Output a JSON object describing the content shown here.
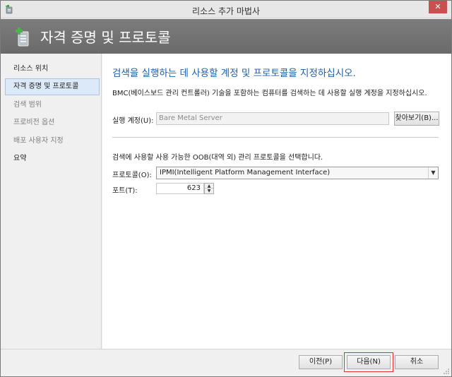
{
  "window": {
    "title": "리소스 추가 마법사",
    "close_glyph": "✕"
  },
  "banner": {
    "title": "자격 증명 및 프로토콜",
    "icon": "wizard-page-icon"
  },
  "nav": {
    "items": [
      {
        "label": "리소스 위치",
        "state": "normal"
      },
      {
        "label": "자격 증명 및 프로토콜",
        "state": "selected"
      },
      {
        "label": "검색 범위",
        "state": "disabled"
      },
      {
        "label": "프로비전 옵션",
        "state": "disabled"
      },
      {
        "label": "배포 사용자 지정",
        "state": "disabled"
      },
      {
        "label": "요약",
        "state": "normal"
      }
    ]
  },
  "main": {
    "heading": "검색을 실행하는 데 사용할 계정 및 프로토콜을 지정하십시오.",
    "description": "BMC(베이스보드 관리 컨트롤러) 기술을 포함하는 컴퓨터를 검색하는 데 사용할 실행 계정을 지정하십시오.",
    "run_as_label": "실행 계정(U):",
    "run_as_value": "Bare Metal Server",
    "browse_label": "찾아보기(B)...",
    "protocol_intro": "검색에 사용할 사용 가능한 OOB(대역 외) 관리 프로토콜을 선택합니다.",
    "protocol_label": "프로토콜(O):",
    "protocol_value": "IPMI(Intelligent Platform Management Interface)",
    "port_label": "포트(T):",
    "port_value": "623"
  },
  "footer": {
    "prev_label": "이전(P)",
    "next_label": "다음(N)",
    "cancel_label": "취소"
  },
  "colors": {
    "heading": "#1f5fa8",
    "banner": "#6e6e6e",
    "selected_nav": "#dbe9f8",
    "highlight": "#e03030"
  }
}
